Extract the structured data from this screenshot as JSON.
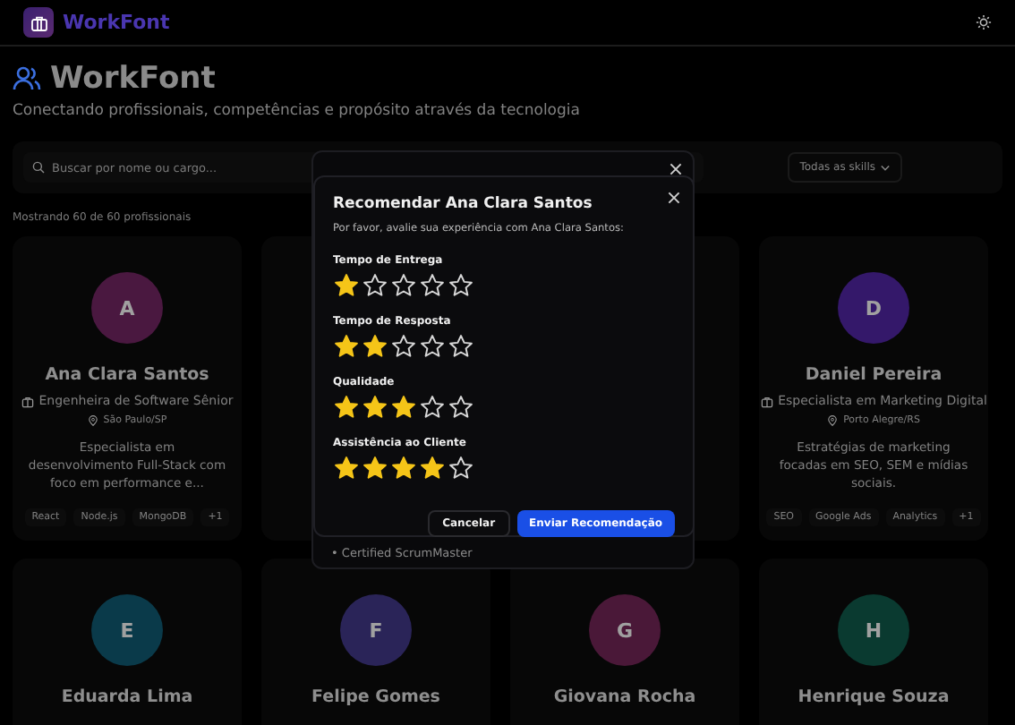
{
  "header": {
    "brand": "WorkFont"
  },
  "page": {
    "title": "WorkFont",
    "subtitle": "Conectando profissionais, competências e propósito através da tecnologia"
  },
  "filters": {
    "search": {
      "placeholder": "Buscar por nome ou cargo..."
    },
    "skill_select": {
      "value": "Todas as skills"
    }
  },
  "result_count": "Mostrando 60 de 60 profissionais",
  "cards": [
    {
      "initial": "A",
      "color": "#4a1840",
      "name": "Ana Clara Santos",
      "role": "Engenheira de Software Sênior",
      "location": "São Paulo/SP",
      "description": "Especialista em desenvolvimento Full-Stack com foco em performance e...",
      "tags": [
        "React",
        "Node.js",
        "MongoDB",
        "+1"
      ]
    },
    {
      "initial": "D",
      "color": "#34186a",
      "name": "Daniel Pereira",
      "role": "Especialista em Marketing Digital",
      "location": "Porto Alegre/RS",
      "description": "Estratégias de marketing focadas em SEO, SEM e mídias sociais.",
      "tags": [
        "SEO",
        "Google Ads",
        "Analytics",
        "+1"
      ]
    },
    {
      "initial": "E",
      "color": "#0a3a4a",
      "name": "Eduarda Lima"
    },
    {
      "initial": "F",
      "color": "#2a2458",
      "name": "Felipe Gomes"
    },
    {
      "initial": "G",
      "color": "#4a1838",
      "name": "Giovana Rocha"
    },
    {
      "initial": "H",
      "color": "#0a3a30",
      "name": "Henrique Souza"
    }
  ],
  "profile_dialog": {
    "certification": "• Certified ScrumMaster"
  },
  "recommend_dialog": {
    "title": "Recomendar Ana Clara Santos",
    "prompt": "Por favor, avalie sua experiência com Ana Clara Santos:",
    "ratings": [
      {
        "label": "Tempo de Entrega",
        "stars": 1
      },
      {
        "label": "Tempo de Resposta",
        "stars": 2
      },
      {
        "label": "Qualidade",
        "stars": 3
      },
      {
        "label": "Assistência ao Cliente",
        "stars": 4
      }
    ],
    "buttons": {
      "cancel": "Cancelar",
      "submit": "Enviar Recomendação"
    }
  }
}
